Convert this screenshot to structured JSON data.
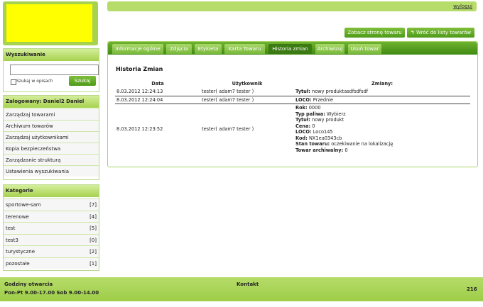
{
  "header": {
    "logout": "wyloguj"
  },
  "actions": {
    "view_store": "Zobacz stronę towaru",
    "back_to_list": "Wróć do listy towarów",
    "back_icon": "arrow-back-icon"
  },
  "tabs": [
    {
      "label": "Informacje ogólne"
    },
    {
      "label": "Zdjęcia"
    },
    {
      "label": "Etykieta"
    },
    {
      "label": "Karta Towaru"
    },
    {
      "label": "Historia zmian"
    },
    {
      "label": "Archiwizuj"
    },
    {
      "label": "Usuń towar"
    }
  ],
  "active_tab": "Historia zmian",
  "history": {
    "title": "Historia Zmian",
    "columns": [
      "Data",
      "Użytkownik",
      "Zmiany:"
    ],
    "rows": [
      {
        "date": "8.03.2012 12:24:13",
        "user": "tester( adam7 tester )",
        "changes": [
          {
            "k": "Tytuł:",
            "v": " nowy produktasdfsdfsdf"
          }
        ]
      },
      {
        "date": "8.03.2012 12:24:04",
        "user": "tester( adam7 tester )",
        "changes": [
          {
            "k": "LOCO:",
            "v": " Przednie"
          }
        ]
      },
      {
        "date": "8.03.2012 12:23:52",
        "user": "tester( adam7 tester )",
        "changes": [
          {
            "k": "Rok:",
            "v": " 0000"
          },
          {
            "k": "Typ paliwa:",
            "v": " Wybierz"
          },
          {
            "k": "Tytuł:",
            "v": " nowy produkt"
          },
          {
            "k": "Cena:",
            "v": " 0"
          },
          {
            "k": "LOCO:",
            "v": " Loco145"
          },
          {
            "k": "Kod:",
            "v": " NX1ea0343cb"
          },
          {
            "k": "Stan towaru:",
            "v": " oczekiwanie na lokalizację"
          },
          {
            "k": "Towar archiwalny:",
            "v": " 0"
          }
        ]
      }
    ]
  },
  "search": {
    "title": "Wyszukiwanie",
    "value": "",
    "checkbox_label": "Szukaj w opisach",
    "button": "Szukaj"
  },
  "menu": {
    "title": "Zalogowany: Daniel2 Daniel",
    "items": [
      "Zarządzaj towarami",
      "Archiwum towarów",
      "Zarządzaj użytkownikami",
      "Kopia bezpieczeństwa",
      "Zarządzanie strukturą",
      "Ustawienia wyszukiwania"
    ]
  },
  "categories": {
    "title": "Kategorie",
    "items": [
      {
        "name": "sportowe-sam",
        "count": "[7]"
      },
      {
        "name": "terenowe",
        "count": "[4]"
      },
      {
        "name": "test",
        "count": "[5]"
      },
      {
        "name": "test3",
        "count": "[0]"
      },
      {
        "name": "turystyczne",
        "count": "[2]"
      },
      {
        "name": "pozostałe",
        "count": "[1]"
      }
    ]
  },
  "footer": {
    "hours_title": "Godziny otwarcia",
    "hours": "Pon-Pt 9.00-17.00 Sob 9.00-14.00",
    "contact": "Kontakt",
    "number": "216"
  },
  "colors": {
    "accent": "#4e9a1a",
    "logo": "#ffff00",
    "light_green": "#b6dc6a"
  }
}
